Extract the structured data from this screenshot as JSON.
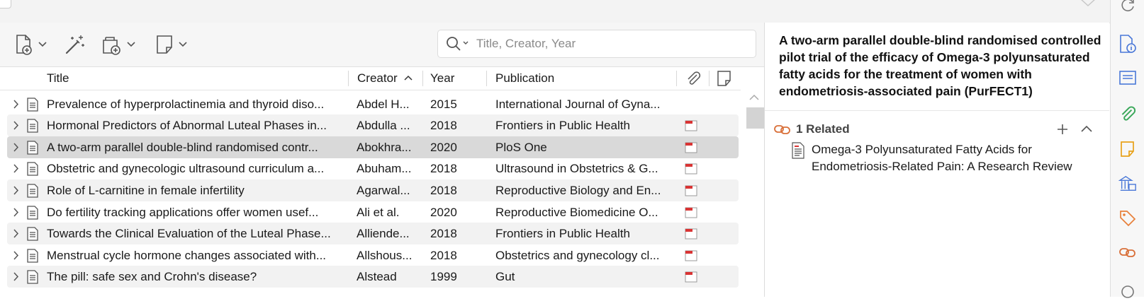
{
  "search": {
    "placeholder": "Title, Creator, Year",
    "value": ""
  },
  "toolbar": {
    "new_item_icon": "new-item-icon",
    "wand_icon": "magic-wand-icon",
    "new_collection_icon": "new-collection-icon",
    "new_note_icon": "new-note-icon"
  },
  "columns": {
    "title": "Title",
    "creator": "Creator",
    "year": "Year",
    "publication": "Publication",
    "sort_indicator": "^"
  },
  "rows": [
    {
      "title": "Prevalence of hyperprolactinemia and thyroid diso...",
      "creator": "Abdel H...",
      "year": "2015",
      "publication": "International Journal of Gyna...",
      "pdf": false
    },
    {
      "title": "Hormonal Predictors of Abnormal Luteal Phases in...",
      "creator": "Abdulla ...",
      "year": "2018",
      "publication": "Frontiers in Public Health",
      "pdf": true
    },
    {
      "title": "A two-arm parallel double-blind randomised contr...",
      "creator": "Abokhra...",
      "year": "2020",
      "publication": "PloS One",
      "pdf": true,
      "selected": true
    },
    {
      "title": "Obstetric and gynecologic ultrasound curriculum a...",
      "creator": "Abuham...",
      "year": "2018",
      "publication": "Ultrasound in Obstetrics & G...",
      "pdf": true
    },
    {
      "title": "Role of L-carnitine in female infertility",
      "creator": "Agarwal...",
      "year": "2018",
      "publication": "Reproductive Biology and En...",
      "pdf": true
    },
    {
      "title": "Do fertility tracking applications offer women usef...",
      "creator": "Ali et al.",
      "year": "2020",
      "publication": "Reproductive Biomedicine O...",
      "pdf": true
    },
    {
      "title": "Towards the Clinical Evaluation of the Luteal Phase...",
      "creator": "Alliende...",
      "year": "2018",
      "publication": "Frontiers in Public Health",
      "pdf": true
    },
    {
      "title": "Menstrual cycle hormone changes associated with...",
      "creator": "Allshous...",
      "year": "2018",
      "publication": "Obstetrics and gynecology cl...",
      "pdf": true
    },
    {
      "title": "The pill: safe sex and Crohn's disease?",
      "creator": "Alstead",
      "year": "1999",
      "publication": "Gut",
      "pdf": true
    }
  ],
  "item_pane": {
    "title": "A two-arm parallel double-blind randomised controlled pilot trial of the efficacy of Omega-3 polyunsaturated fatty acids for the treatment of women with endometriosis-associated pain (PurFECT1)",
    "related_label": "1 Related",
    "related_items": [
      "Omega-3 Polyunsaturated Fatty Acids for Endometriosis-Related Pain: A Research Review"
    ]
  },
  "colors": {
    "accent_blue": "#4a78d8",
    "attachment_green": "#3aa85a",
    "note_yellow": "#e8a21a",
    "tag_orange": "#e8803a",
    "related_orange": "#d9703a",
    "pdf_red": "#d93434"
  }
}
